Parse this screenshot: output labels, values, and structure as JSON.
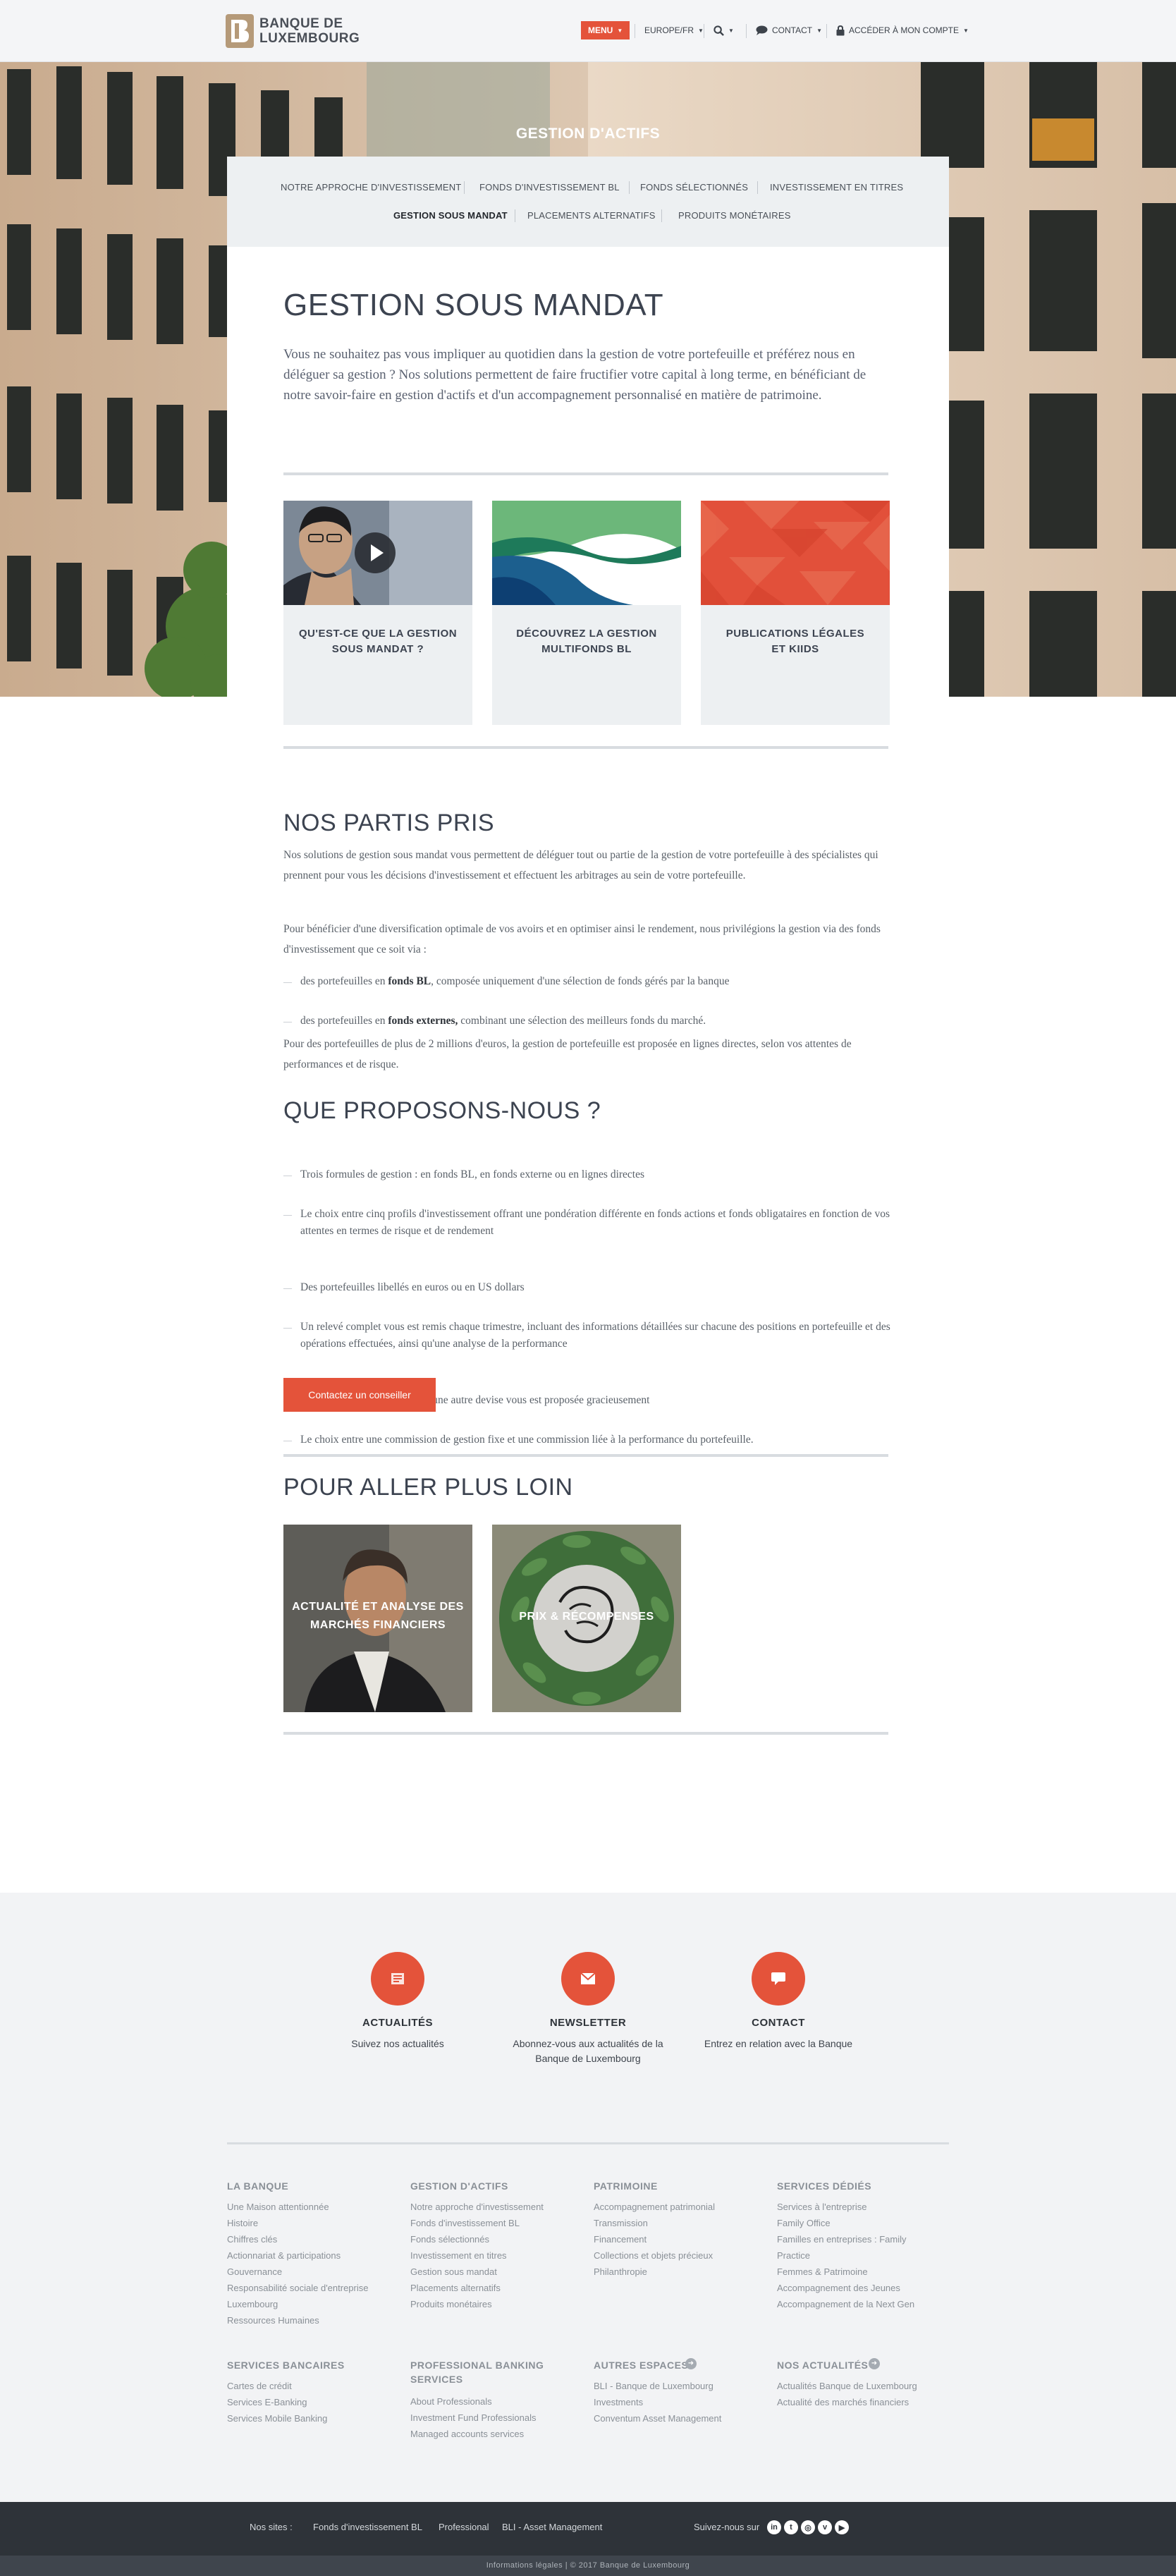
{
  "header": {
    "brand_line1": "BANQUE DE",
    "brand_line2": "LUXEMBOURG",
    "menu_label": "MENU",
    "locale_label": "EUROPE/FR",
    "contact_label": "CONTACT",
    "account_label": "ACCÉDER À MON COMPTE"
  },
  "hero": {
    "title": "GESTION D'ACTIFS"
  },
  "tabs": [
    {
      "label": "Notre approche d'investissement"
    },
    {
      "label": "Fonds d'investissement BL"
    },
    {
      "label": "Fonds sélectionnés"
    },
    {
      "label": "Investissement en titres"
    },
    {
      "label": "Gestion sous mandat",
      "active": true
    },
    {
      "label": "Placements alternatifs"
    },
    {
      "label": "Produits monétaires"
    }
  ],
  "main": {
    "title": "GESTION SOUS MANDAT",
    "intro": "Vous ne souhaitez pas vous impliquer au quotidien dans la gestion de votre portefeuille et préférez nous en déléguer sa gestion ? Nos solutions permettent de faire fructifier votre capital à long terme, en bénéficiant de notre savoir-faire en gestion d'actifs et d'un accompagnement personnalisé en matière de patrimoine.",
    "tiles": [
      {
        "line1": "Qu'est-ce que la gestion",
        "line2": "sous mandat ?"
      },
      {
        "line1": "Découvrez la gestion",
        "line2": "multifonds BL"
      },
      {
        "line1": "Publications légales",
        "line2": "et KIIDs"
      }
    ],
    "partis_title": "NOS PARTIS PRIS",
    "partis_p1": "Nos solutions de gestion sous mandat vous permettent de déléguer tout ou partie de la gestion de votre portefeuille à des spécialistes qui prennent pour vous les décisions d'investissement et effectuent les arbitrages au sein de votre portefeuille.",
    "partis_p2": "Pour bénéficier d'une diversification optimale de vos avoirs et en optimiser ainsi le rendement, nous privilégions la gestion via des fonds d'investissement que ce soit via :",
    "partis_b1_pre": "des portefeuilles en ",
    "partis_b1_strong": "fonds BL",
    "partis_b1_post": ", composée uniquement d'une sélection de fonds gérés par la banque",
    "partis_b2_pre": "des portefeuilles en ",
    "partis_b2_strong": "fonds externes,",
    "partis_b2_post": " combinant une sélection des meilleurs fonds du marché.",
    "partis_p3": "Pour des portefeuilles de plus de 2 millions d'euros, la gestion de portefeuille est proposée en lignes directes, selon vos attentes de performances et de risque.",
    "propose_title": "QUE PROPOSONS-NOUS ?",
    "propose_items": [
      "Trois formules de gestion : en fonds BL, en fonds externe ou en lignes directes",
      "Le choix entre cinq profils d'investissement offrant une pondération différente en fonds actions et fonds obligataires en fonction de vos attentes en termes de risque et de rendement",
      "Des portefeuilles libellés en euros ou en US dollars",
      "Un relevé complet vous est remis chaque trimestre, incluant des informations détaillées sur chacune des positions en portefeuille et des opérations effectuées, ainsi qu'une analyse de la performance",
      "L'ouverture d'un compte dans une autre devise vous est proposée gracieusement",
      "Le choix entre une commission de gestion fixe et une commission liée à la performance du portefeuille."
    ],
    "cta_label": "Contactez un conseiller",
    "further_title": "POUR ALLER PLUS LOIN",
    "further_tiles": [
      {
        "line1": "Actualité et analyse des",
        "line2": "marchés financiers"
      },
      {
        "line1": "Prix & récompenses",
        "line2": ""
      }
    ]
  },
  "footer": {
    "features": [
      {
        "title": "ACTUALITÉS",
        "line1": "Suivez nos actualités",
        "line2": ""
      },
      {
        "title": "NEWSLETTER",
        "line1": "Abonnez-vous aux actualités de la",
        "line2": "Banque de Luxembourg"
      },
      {
        "title": "CONTACT",
        "line1": "Entrez en relation avec la Banque",
        "line2": ""
      }
    ],
    "columns": [
      {
        "title": "LA BANQUE",
        "links": [
          "Une Maison attentionnée",
          "Histoire",
          "Chiffres clés",
          "Actionnariat & participations",
          "Gouvernance",
          "Responsabilité sociale d'entreprise",
          "Luxembourg",
          "Ressources Humaines"
        ]
      },
      {
        "title": "GESTION D'ACTIFS",
        "links": [
          "Notre approche d'investissement",
          "Fonds d'investissement BL",
          "Fonds sélectionnés",
          "Investissement en titres",
          "Gestion sous mandat",
          "Placements alternatifs",
          "Produits monétaires"
        ]
      },
      {
        "title": "PATRIMOINE",
        "links": [
          "Accompagnement patrimonial",
          "Transmission",
          "Financement",
          "Collections et objets précieux",
          "Philanthropie"
        ]
      },
      {
        "title": "SERVICES DÉDIÉS",
        "links": [
          "Services à l'entreprise",
          "Family Office",
          "Familles en entreprises : Family",
          "Practice",
          "Femmes & Patrimoine",
          "Accompagnement des Jeunes",
          "Accompagnement de la Next Gen"
        ]
      },
      {
        "title": "SERVICES BANCAIRES",
        "links": [
          "Cartes de crédit",
          "Services E-Banking",
          "Services Mobile Banking"
        ]
      },
      {
        "title": "PROFESSIONAL BANKING",
        "title2": "SERVICES",
        "links": [
          "About Professionals",
          "Investment Fund Professionals",
          "Managed accounts services"
        ]
      },
      {
        "title": "AUTRES ESPACES",
        "links": [
          "BLI - Banque de Luxembourg",
          "Investments",
          "Conventum Asset Management"
        ]
      },
      {
        "title": "NOS ACTUALITÉS",
        "links": [
          "Actualités Banque de Luxembourg",
          "Actualité des marchés financiers"
        ]
      }
    ],
    "sites_label": "Nos sites :",
    "sites": [
      "Fonds d'investissement BL",
      "Professional",
      "BLI - Asset Management"
    ],
    "follow_label": "Suivez-nous sur",
    "social_icons": [
      "linkedin-icon",
      "twitter-icon",
      "camera-icon",
      "vimeo-icon",
      "youtube-icon"
    ],
    "legal": "Informations légales | © 2017 Banque de Luxembourg"
  },
  "colors": {
    "accent": "#e4533a",
    "panel": "#edf0f2",
    "footer_dark": "#2e3339"
  }
}
